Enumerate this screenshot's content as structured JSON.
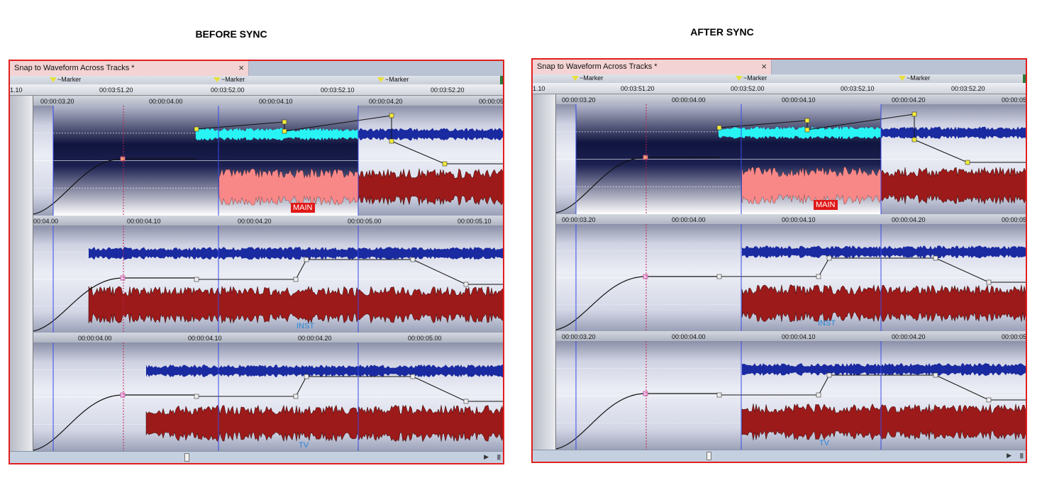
{
  "captions": {
    "before": "BEFORE SYNC",
    "after": "AFTER SYNC"
  },
  "panels": [
    {
      "tab_title": "Snap to Waveform Across Tracks *",
      "close_glyph": "×",
      "markers": [
        "~Marker",
        "~Marker",
        "~Marker"
      ],
      "top_times": [
        "1.10",
        "00:03:51.20",
        "00:03:52.00",
        "00:03:52.10",
        "00:03:52.20"
      ],
      "lanes": [
        {
          "name": "MAIN",
          "times": [
            "00:00:03.20",
            "00:00:04.00",
            "00:00:04.10",
            "00:00:04.20",
            "00:00:05"
          ]
        },
        {
          "name": "INST",
          "times": [
            "00:04.00",
            "00:00:04.10",
            "00:00:04.20",
            "00:00:05.00",
            "00:00:05.10"
          ]
        },
        {
          "name": "TV",
          "times": [
            "00:00:04.00",
            "00:00:04.10",
            "00:00:04.20",
            "00:00:05.00"
          ]
        }
      ]
    },
    {
      "tab_title": "Snap to Waveform Across Tracks *",
      "close_glyph": "×",
      "markers": [
        "~Marker",
        "~Marker",
        "~Marker"
      ],
      "top_times": [
        "1.10",
        "00:03:51.20",
        "00:03:52.00",
        "00:03:52.10",
        "00:03:52.20"
      ],
      "lanes": [
        {
          "name": "MAIN",
          "times": [
            "00:00:03.20",
            "00:00:04.00",
            "00:00:04.10",
            "00:00:04.20",
            "00:00:05"
          ]
        },
        {
          "name": "INST",
          "times": [
            "00:00:03.20",
            "00:00:04.00",
            "00:00:04.10",
            "00:00:04.20",
            "00:00:05"
          ]
        },
        {
          "name": "TV",
          "times": [
            "00:00:03.20",
            "00:00:04.00",
            "00:00:04.10",
            "00:00:04.20",
            "00:00:05"
          ]
        }
      ]
    }
  ],
  "colors": {
    "panel_border": "#e02020",
    "waveform_top": "#1a2aa0",
    "waveform_bottom": "#9c1a1a",
    "selected_top": "#28f4f4",
    "selected_bottom": "#f88888",
    "cursor_line": "#3a4ae8",
    "envelope_point": "#f4ec3a"
  },
  "icons": [
    "close-icon",
    "marker-flag-icon",
    "scroll-right-icon",
    "grip-icon"
  ]
}
